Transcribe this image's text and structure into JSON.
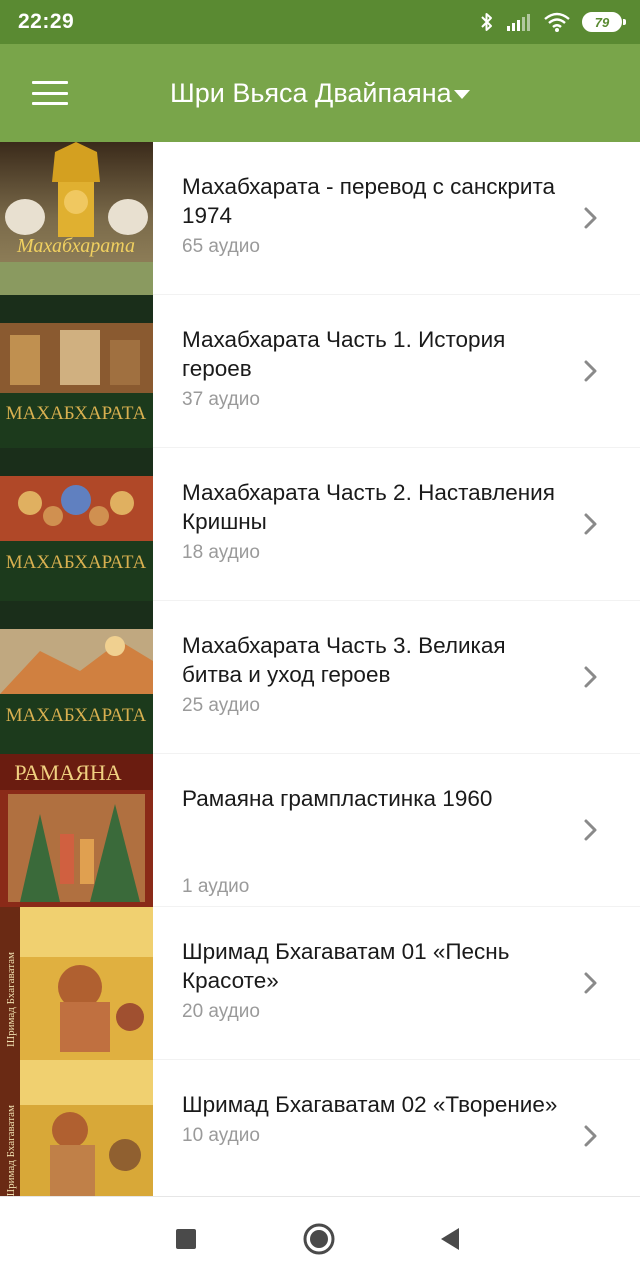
{
  "status_bar": {
    "time": "22:29",
    "battery": "79",
    "icons": [
      "bluetooth-icon",
      "signal-icon",
      "wifi-icon",
      "battery-icon"
    ]
  },
  "app_bar": {
    "title": "Шри Вьяса Двайпаяна",
    "menu_icon": "hamburger-menu-icon",
    "dropdown_icon": "caret-down-icon",
    "background": "#79a54a",
    "status_background": "#5a8a32"
  },
  "list": {
    "items": [
      {
        "title": "Махабхарата - перевод с санскрита 1974",
        "subtitle": "65 аудио",
        "thumb_text": "Махабхарата"
      },
      {
        "title": "Махабхарата Часть 1. История героев",
        "subtitle": "37 аудио",
        "thumb_text": "МАХАБХАРАТА"
      },
      {
        "title": "Махабхарата Часть 2. Наставления Кришны",
        "subtitle": "18 аудио",
        "thumb_text": "МАХАБХАРАТА"
      },
      {
        "title": "Махабхарата Часть 3. Великая битва и уход героев",
        "subtitle": "25 аудио",
        "thumb_text": "МАХАБХАРАТА"
      },
      {
        "title": "Рамаяна грампластинка 1960",
        "subtitle": "1 аудио",
        "thumb_text": "РАМАЯНА"
      },
      {
        "title": "Шримад Бхагаватам 01 «Песнь Красоте»",
        "subtitle": "20 аудио",
        "thumb_text": "Шримад Бхагаватам"
      },
      {
        "title": "Шримад Бхагаватам 02 «Творение»",
        "subtitle": "10 аудио",
        "thumb_text": "Шримад Бхагаватам"
      }
    ]
  },
  "nav_bar": {
    "icons": [
      "recent-apps-icon",
      "home-icon",
      "back-icon"
    ]
  }
}
